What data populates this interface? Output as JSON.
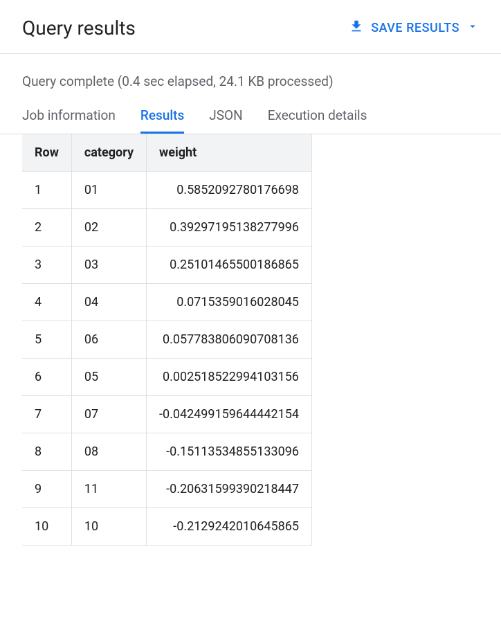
{
  "header": {
    "title": "Query results",
    "save_label": "SAVE RESULTS"
  },
  "status": "Query complete (0.4 sec elapsed, 24.1 KB processed)",
  "tabs": [
    {
      "label": "Job information",
      "active": false
    },
    {
      "label": "Results",
      "active": true
    },
    {
      "label": "JSON",
      "active": false
    },
    {
      "label": "Execution details",
      "active": false
    }
  ],
  "table": {
    "columns": [
      "Row",
      "category",
      "weight"
    ],
    "rows": [
      {
        "row": "1",
        "category": "01",
        "weight": "0.5852092780176698"
      },
      {
        "row": "2",
        "category": "02",
        "weight": "0.39297195138277996"
      },
      {
        "row": "3",
        "category": "03",
        "weight": "0.25101465500186865"
      },
      {
        "row": "4",
        "category": "04",
        "weight": "0.0715359016028045"
      },
      {
        "row": "5",
        "category": "06",
        "weight": "0.057783806090708136"
      },
      {
        "row": "6",
        "category": "05",
        "weight": "0.002518522994103156"
      },
      {
        "row": "7",
        "category": "07",
        "weight": "-0.042499159644442154"
      },
      {
        "row": "8",
        "category": "08",
        "weight": "-0.15113534855133096"
      },
      {
        "row": "9",
        "category": "11",
        "weight": "-0.20631599390218447"
      },
      {
        "row": "10",
        "category": "10",
        "weight": "-0.2129242010645865"
      }
    ]
  }
}
